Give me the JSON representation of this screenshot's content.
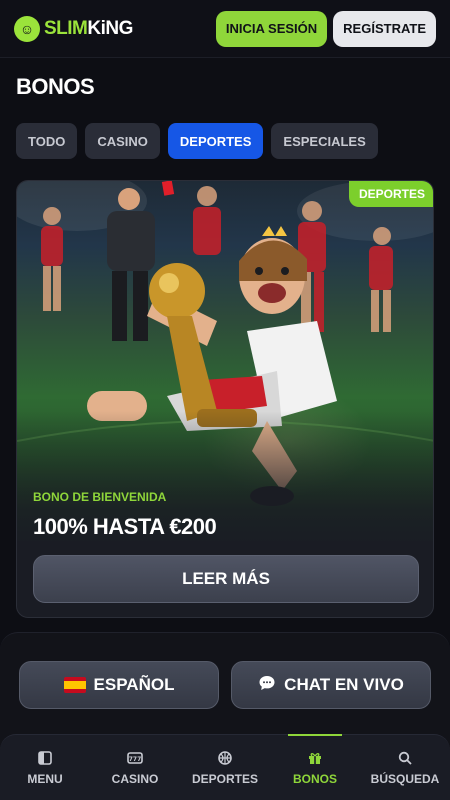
{
  "header": {
    "logo_slim": "SLIM",
    "logo_king": "KiNG",
    "login_label": "INICIA SESIÓN",
    "register_label": "REGÍSTRATE"
  },
  "page": {
    "title": "BONOS"
  },
  "tabs": [
    {
      "label": "TODO",
      "active": false
    },
    {
      "label": "CASINO",
      "active": false
    },
    {
      "label": "DEPORTES",
      "active": true
    },
    {
      "label": "ESPECIALES",
      "active": false
    }
  ],
  "promo": {
    "badge": "DEPORTES",
    "subtitle": "BONO DE BIENVENIDA",
    "title": "100% HASTA €200",
    "cta_label": "LEER MÁS"
  },
  "footer": {
    "language_label": "ESPAÑOL",
    "chat_label": "CHAT EN VIVO"
  },
  "nav": [
    {
      "label": "MENU",
      "icon": "menu-icon",
      "active": false
    },
    {
      "label": "CASINO",
      "icon": "casino-icon",
      "active": false
    },
    {
      "label": "DEPORTES",
      "icon": "basketball-icon",
      "active": false
    },
    {
      "label": "BONOS",
      "icon": "gift-icon",
      "active": true
    },
    {
      "label": "BÚSQUEDA",
      "icon": "search-icon",
      "active": false
    }
  ],
  "colors": {
    "accent_green": "#8fd63a",
    "active_tab_blue": "#1657e6",
    "background": "#0d0e14"
  }
}
